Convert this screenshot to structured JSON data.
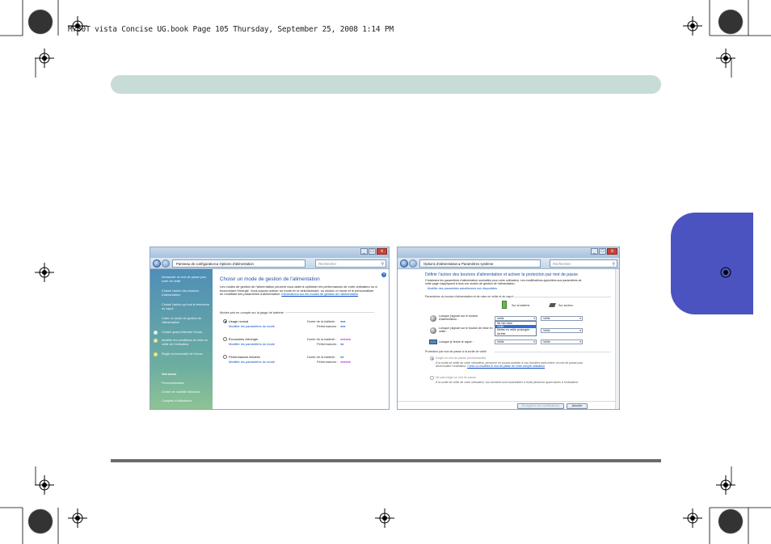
{
  "header": {
    "file_line": "M730T vista Concise UG.book  Page 105  Thursday, September 25, 2008  1:14 PM"
  },
  "left_window": {
    "address": {
      "panneau": "Panneau de configuration",
      "options": "Options d'alimentation"
    },
    "search_placeholder": "Rechercher",
    "sidebar": {
      "links": [
        "Demander un mot de passe pour sortir de veille",
        "Choisir l'action des boutons d'alimentation",
        "Choisir l'action qui suit la fermeture du capot",
        "Créer un mode de gestion de l'alimentation",
        "Choisir quand éteindre l'écran",
        "Modifier les conditions de mise en veille de l'ordinateur",
        "Régler la luminosité de l'écran"
      ],
      "see_also_heading": "Voir aussi",
      "see_also": [
        "Personnalisation",
        "Centre de mobilité Windows",
        "Comptes d'utilisateurs"
      ]
    },
    "title": "Choisir un mode de gestion de l'alimentation",
    "intro": "Les modes de gestion de l'alimentation peuvent vous aider à optimiser les performances de votre ordinateur ou à économiser l'énergie. Vous pouvez activer un mode en le sélectionnant, ou choisir un mode et le personnaliser en modifiant ses paramètres d'alimentation.",
    "intro_link": "Informations sur les modes de gestion de l'alimentation",
    "section_heading": "Modes pris en compte sur la jauge de batterie",
    "plans": [
      {
        "name": "Usage normal",
        "edit": "Modifier les paramètres du mode",
        "battery_label": "Durée de la batterie :",
        "perf_label": "Performances :",
        "battery": "●●●",
        "perf": "●●●",
        "selected": true
      },
      {
        "name": "Économies d'énergie",
        "edit": "Modifier les paramètres du mode",
        "battery_label": "Durée de la batterie :",
        "perf_label": "Performances :",
        "battery": "●●●●●●",
        "perf": "●●",
        "selected": false
      },
      {
        "name": "Performances élevées",
        "edit": "Modifier les paramètres du mode",
        "battery_label": "Durée de la batterie :",
        "perf_label": "Performances :",
        "battery": "●●",
        "perf": "●●●●●●",
        "selected": false
      }
    ]
  },
  "right_window": {
    "address": {
      "options": "Options d'alimentation",
      "params": "Paramètres système"
    },
    "search_placeholder": "Rechercher",
    "title": "Définir l'action des boutons d'alimentation et activer la protection par mot de passe",
    "intro": "Choisissez les paramètres d'alimentation souhaités pour votre ordinateur. Les modifications apportées aux paramètres de cette page s'appliquent à tous vos modes de gestion de l'alimentation.",
    "unavailable_link": "Modifier des paramètres actuellement non disponibles",
    "buttons_section": "Paramètres du bouton d'alimentation et de mise en veille et du capot",
    "col_battery": "Sur la batterie",
    "col_ac": "Sur secteur",
    "rows": [
      {
        "label": "Lorsque j'appuie sur le bouton d'alimentation :",
        "battery": "Veille",
        "ac": "Veille"
      },
      {
        "label": "Lorsque j'appuie sur le bouton de mise en veille :",
        "battery": "Veille",
        "ac": "Veille"
      },
      {
        "label": "Lorsque je ferme le capot :",
        "battery": "Veille",
        "ac": "Veille"
      }
    ],
    "dropdown_options": [
      "Ne rien faire",
      "Veille",
      "Mettre en veille prolongée",
      "Arrêter"
    ],
    "password_section": "Protection par mot de passe à la sortie de veille",
    "require_label": "Exiger un mot de passe (recommandé)",
    "require_text": "À la sortie de veille de votre ordinateur, personne ne pourra accéder à vos données sans entrer un mot de passe pour déverrouiller l'ordinateur.",
    "require_link": "Créez ou modifiez le mot de passe de votre compte utilisateur",
    "no_require_label": "Ne pas exiger un mot de passe",
    "no_require_text": "À la sortie de veille de votre ordinateur, vos données sont accessibles à toute personne ayant accès à l'ordinateur.",
    "save_button": "Enregistrer les modifications",
    "cancel_button": "Annuler"
  },
  "colors": {
    "top_bar": "#c7dcd6",
    "side_tab": "#4a53bf",
    "bottom_rule": "#6b6b6b"
  }
}
